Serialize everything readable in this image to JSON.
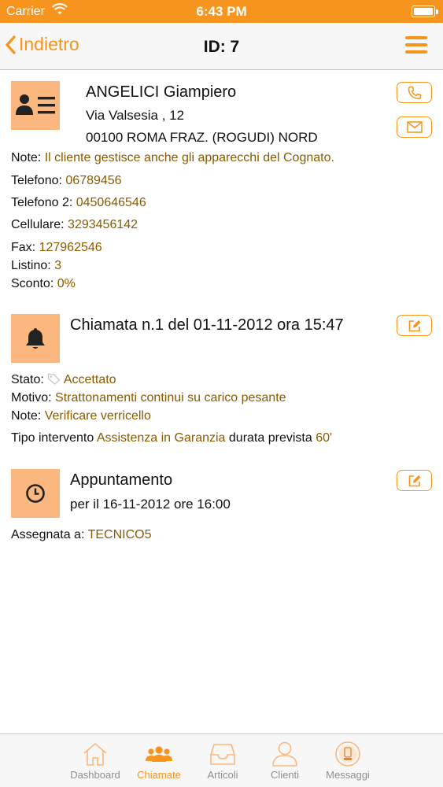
{
  "status_bar": {
    "carrier": "Carrier",
    "time": "6:43 PM"
  },
  "nav": {
    "back_label": "Indietro",
    "title": "ID: 7"
  },
  "client": {
    "name": "ANGELICI Giampiero",
    "address": "Via Valsesia , 12",
    "city": "00100  ROMA FRAZ. (ROGUDI)  NORD",
    "note_label": "Note:",
    "note_value": "Il cliente gestisce anche gli apparecchi del Cognato.",
    "phone_label": "Telefono:",
    "phone_value": "06789456",
    "phone2_label": "Telefono 2:",
    "phone2_value": "0450646546",
    "mobile_label": "Cellulare:",
    "mobile_value": "3293456142",
    "fax_label": "Fax:",
    "fax_value": "127962546",
    "listino_label": "Listino:",
    "listino_value": "3",
    "sconto_label": "Sconto:",
    "sconto_value": "0%"
  },
  "call": {
    "title": "Chiamata n.1 del 01-11-2012 ora 15:47",
    "stato_label": "Stato:",
    "stato_value": "Accettato",
    "motivo_label": "Motivo:",
    "motivo_value": "Strattonamenti continui su carico pesante",
    "note_label": "Note:",
    "note_value": "Verificare verricello",
    "tipo_label": "Tipo intervento",
    "tipo_value": "Assistenza in Garanzia",
    "durata_label": "durata prevista",
    "durata_value": "60'"
  },
  "appointment": {
    "title": "Appuntamento",
    "when": "per il 16-11-2012 ore 16:00",
    "assigned_label": "Assegnata a:",
    "assigned_value": "TECNICO5"
  },
  "tabs": [
    {
      "label": "Dashboard",
      "icon": "home-icon"
    },
    {
      "label": "Chiamate",
      "icon": "people-icon"
    },
    {
      "label": "Articoli",
      "icon": "inbox-icon"
    },
    {
      "label": "Clienti",
      "icon": "person-icon"
    },
    {
      "label": "Messaggi",
      "icon": "message-icon"
    }
  ],
  "colors": {
    "accent": "#f7941d",
    "icon_bg": "#fbb77e",
    "value_text": "#8a5a00"
  }
}
